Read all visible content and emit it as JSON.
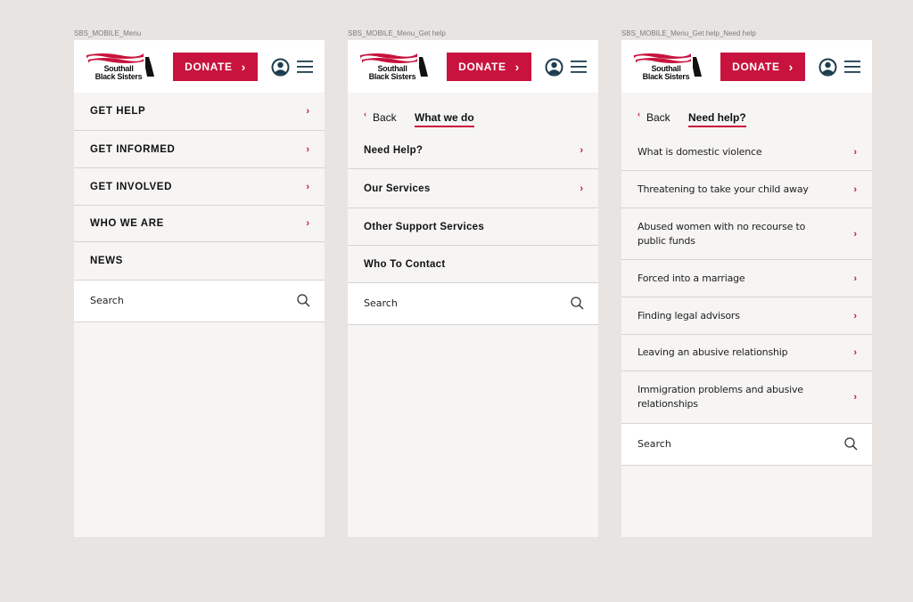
{
  "frames": [
    {
      "label": "SBS_MOBILE_Menu",
      "rows": [
        {
          "label": "GET HELP",
          "arrow": "›"
        },
        {
          "label": "GET INFORMED",
          "arrow": "›"
        },
        {
          "label": "GET INVOLVED",
          "arrow": "›"
        },
        {
          "label": "WHO WE ARE",
          "arrow": "›"
        },
        {
          "label": "NEWS",
          "arrow": ""
        }
      ]
    },
    {
      "label": "SBS_MOBILE_Menu_Get help",
      "back": "Back",
      "title": "What we do",
      "rows": [
        {
          "label": "Need Help?",
          "arrow": "›"
        },
        {
          "label": "Our Services",
          "arrow": "›"
        },
        {
          "label": "Other Support Services",
          "arrow": ""
        },
        {
          "label": "Who To Contact",
          "arrow": ""
        }
      ]
    },
    {
      "label": "SBS_MOBILE_Menu_Get help_Need help",
      "back": "Back",
      "title": "Need help?",
      "rows": [
        {
          "label": "What is domestic violence",
          "arrow": "›"
        },
        {
          "label": "Threatening to take your child away",
          "arrow": "›"
        },
        {
          "label": "Abused women with no recourse to public funds",
          "arrow": "›"
        },
        {
          "label": "Forced into a marriage",
          "arrow": "›"
        },
        {
          "label": "Finding legal advisors",
          "arrow": "›"
        },
        {
          "label": "Leaving an abusive relationship",
          "arrow": "›"
        },
        {
          "label": "Immigration problems and abusive relationships",
          "arrow": "›"
        }
      ]
    }
  ],
  "header": {
    "logo_line1": "Southall",
    "logo_line2": "Black Sisters",
    "donate_label": "DONATE",
    "donate_chevron": "›"
  },
  "search": {
    "label": "Search"
  },
  "icons": {
    "account": "account-circle-icon",
    "menu": "hamburger-menu-icon",
    "search": "search-icon",
    "back": "chevron-left-icon",
    "row": "chevron-right-icon"
  },
  "colors": {
    "brand_red": "#c8133e",
    "page_bg": "#e7e4e2",
    "menu_bg": "#f6f5f4",
    "icon_navy": "#1d3d4f"
  }
}
